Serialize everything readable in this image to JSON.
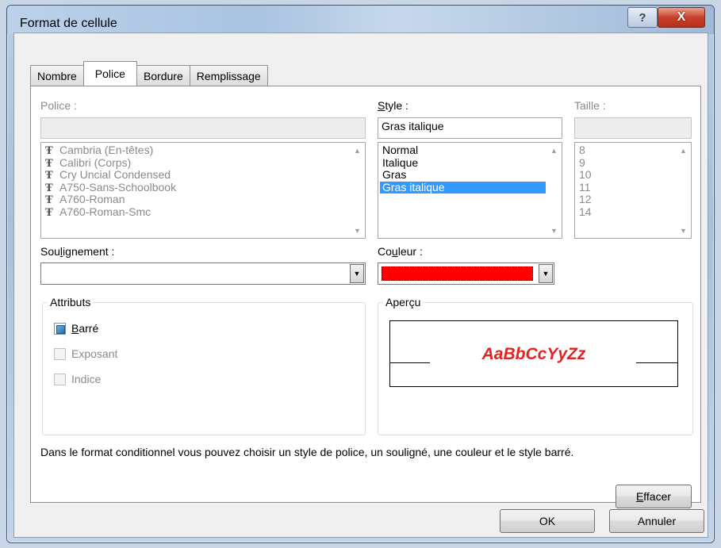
{
  "window": {
    "title": "Format de cellule",
    "help_glyph": "?",
    "close_glyph": "X"
  },
  "tabs": [
    "Nombre",
    "Police",
    "Bordure",
    "Remplissage"
  ],
  "active_tab": "Police",
  "font": {
    "label": "Police :",
    "value": "",
    "items": [
      "Cambria (En-têtes)",
      "Calibri (Corps)",
      "Cry Uncial Condensed",
      "A750-Sans-Schoolbook",
      "A760-Roman",
      "A760-Roman-Smc"
    ]
  },
  "style": {
    "label_prefix": "S",
    "label_rest": "tyle :",
    "value": "Gras italique",
    "items": [
      "Normal",
      "Italique",
      "Gras",
      "Gras italique"
    ],
    "selected": "Gras italique"
  },
  "size": {
    "label": "Taille :",
    "value": "",
    "items": [
      "8",
      "9",
      "10",
      "11",
      "12",
      "14"
    ]
  },
  "underline": {
    "label_pre": "Sou",
    "label_acc": "l",
    "label_post": "ignement :",
    "value": ""
  },
  "color": {
    "label_pre": "Co",
    "label_acc": "u",
    "label_post": "leur :",
    "value": "#ff0000"
  },
  "attributes": {
    "title": "Attributs",
    "strikethrough": {
      "acc": "B",
      "rest": "arré",
      "checked": true
    },
    "superscript": {
      "label": "Exposant",
      "checked": false
    },
    "subscript": {
      "label": "Indice",
      "checked": false
    }
  },
  "preview": {
    "title": "Aperçu",
    "sample": "AaBbCcYyZz"
  },
  "note": "Dans le format conditionnel vous pouvez choisir un style de police, un souligné, une couleur et le style barré.",
  "buttons": {
    "clear_acc": "E",
    "clear_rest": "ffacer",
    "ok": "OK",
    "cancel": "Annuler"
  }
}
